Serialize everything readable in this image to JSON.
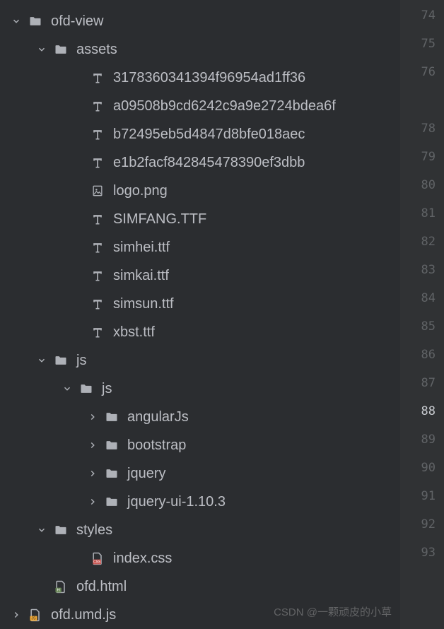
{
  "tree": {
    "root": {
      "name": "ofd-view",
      "children": {
        "assets": {
          "name": "assets",
          "files": {
            "f1": "3178360341394f96954ad1ff36",
            "f2": "a09508b9cd6242c9a9e2724bdea6f",
            "f3": "b72495eb5d4847d8bfe018aec",
            "f4": "e1b2facf842845478390ef3dbb",
            "logo": "logo.png",
            "simfang": "SIMFANG.TTF",
            "simhei": "simhei.ttf",
            "simkai": "simkai.ttf",
            "simsun": "simsun.ttf",
            "xbst": "xbst.ttf"
          }
        },
        "js": {
          "name": "js",
          "inner_js": {
            "name": "js",
            "folders": {
              "angular": "angularJs",
              "bootstrap": "bootstrap",
              "jquery": "jquery",
              "jqueryui": "jquery-ui-1.10.3"
            }
          }
        },
        "styles": {
          "name": "styles",
          "files": {
            "index_css": "index.css"
          }
        },
        "ofd_html": "ofd.html",
        "ofd_umd": "ofd.umd.js"
      }
    }
  },
  "gutter": {
    "l0": "74",
    "l1": "75",
    "l2": "76",
    "l3": "",
    "l4": "78",
    "l5": "79",
    "l6": "80",
    "l7": "81",
    "l8": "82",
    "l9": "83",
    "l10": "84",
    "l11": "85",
    "l12": "86",
    "l13": "87",
    "l14": "88",
    "l15": "89",
    "l16": "90",
    "l17": "91",
    "l18": "92",
    "l19": "93",
    "l20": ""
  },
  "watermark": "CSDN @一颗顽皮的小草"
}
